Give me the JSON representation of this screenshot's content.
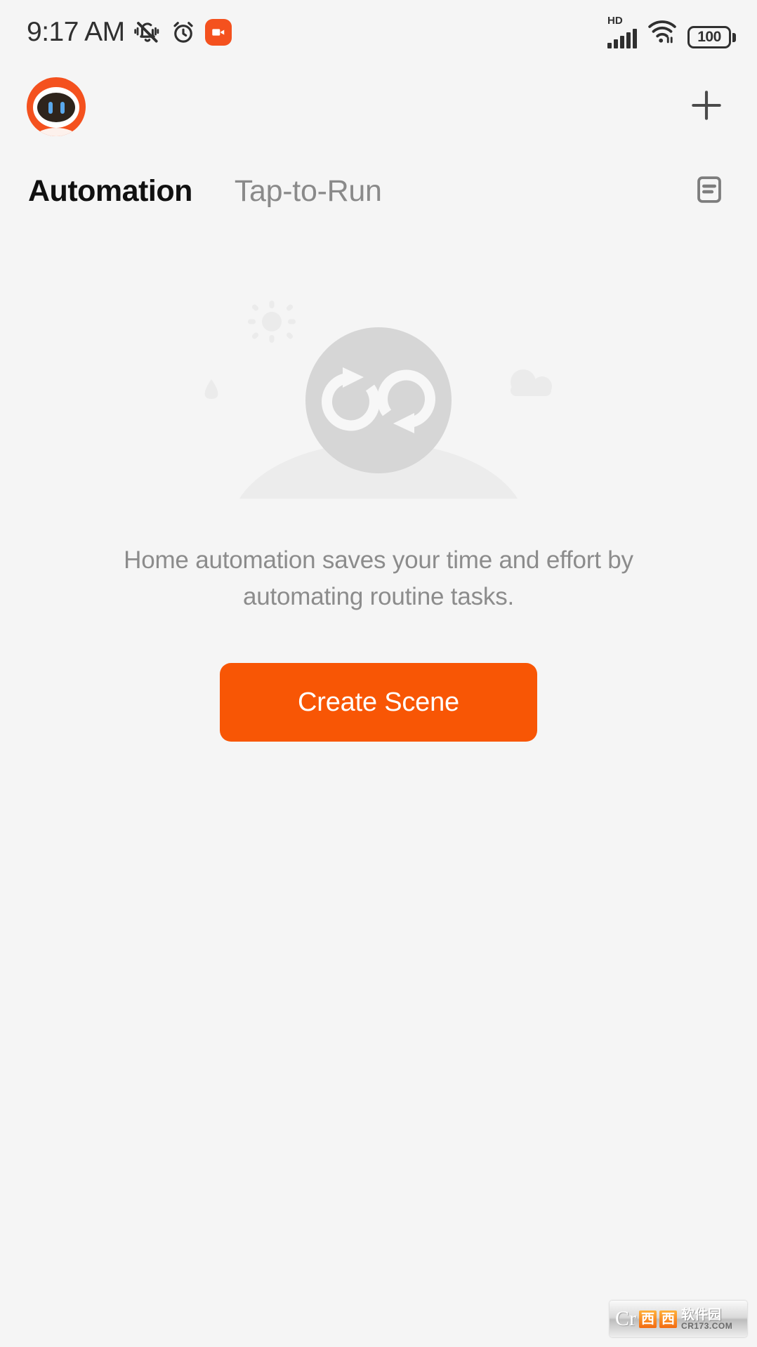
{
  "status_bar": {
    "time": "9:17 AM",
    "icons": [
      "mute-bell-icon",
      "alarm-clock-icon",
      "screen-recording-icon"
    ],
    "network_label": "HD",
    "signal_icon": "cellular-signal-icon",
    "wifi_icon": "wifi-icon",
    "battery_level": "100"
  },
  "header": {
    "avatar_icon": "robot-avatar-icon",
    "add_label": "+",
    "add_icon": "plus-icon"
  },
  "tabs": [
    {
      "label": "Automation",
      "active": true
    },
    {
      "label": "Tap-to-Run",
      "active": false
    }
  ],
  "log_icon": "automation-log-icon",
  "empty_state": {
    "illustration_icon": "automation-loop-icon",
    "decor_icons": [
      "sun-icon",
      "water-drop-icon",
      "cloud-icon",
      "hill-shape"
    ],
    "message": "Home automation saves your time and effort by automating routine tasks.",
    "cta_label": "Create Scene"
  },
  "watermark": {
    "monogram": "Cr",
    "box_one": "西",
    "box_two": "西",
    "name_cn": "软件园",
    "url": "CR173.COM"
  },
  "colors": {
    "accent": "#f85605",
    "avatar_ring": "#f4511e",
    "background": "#f5f5f5",
    "active_tab": "#111111",
    "inactive_tab": "#8a8a8a",
    "body_text": "#8c8c8c"
  }
}
